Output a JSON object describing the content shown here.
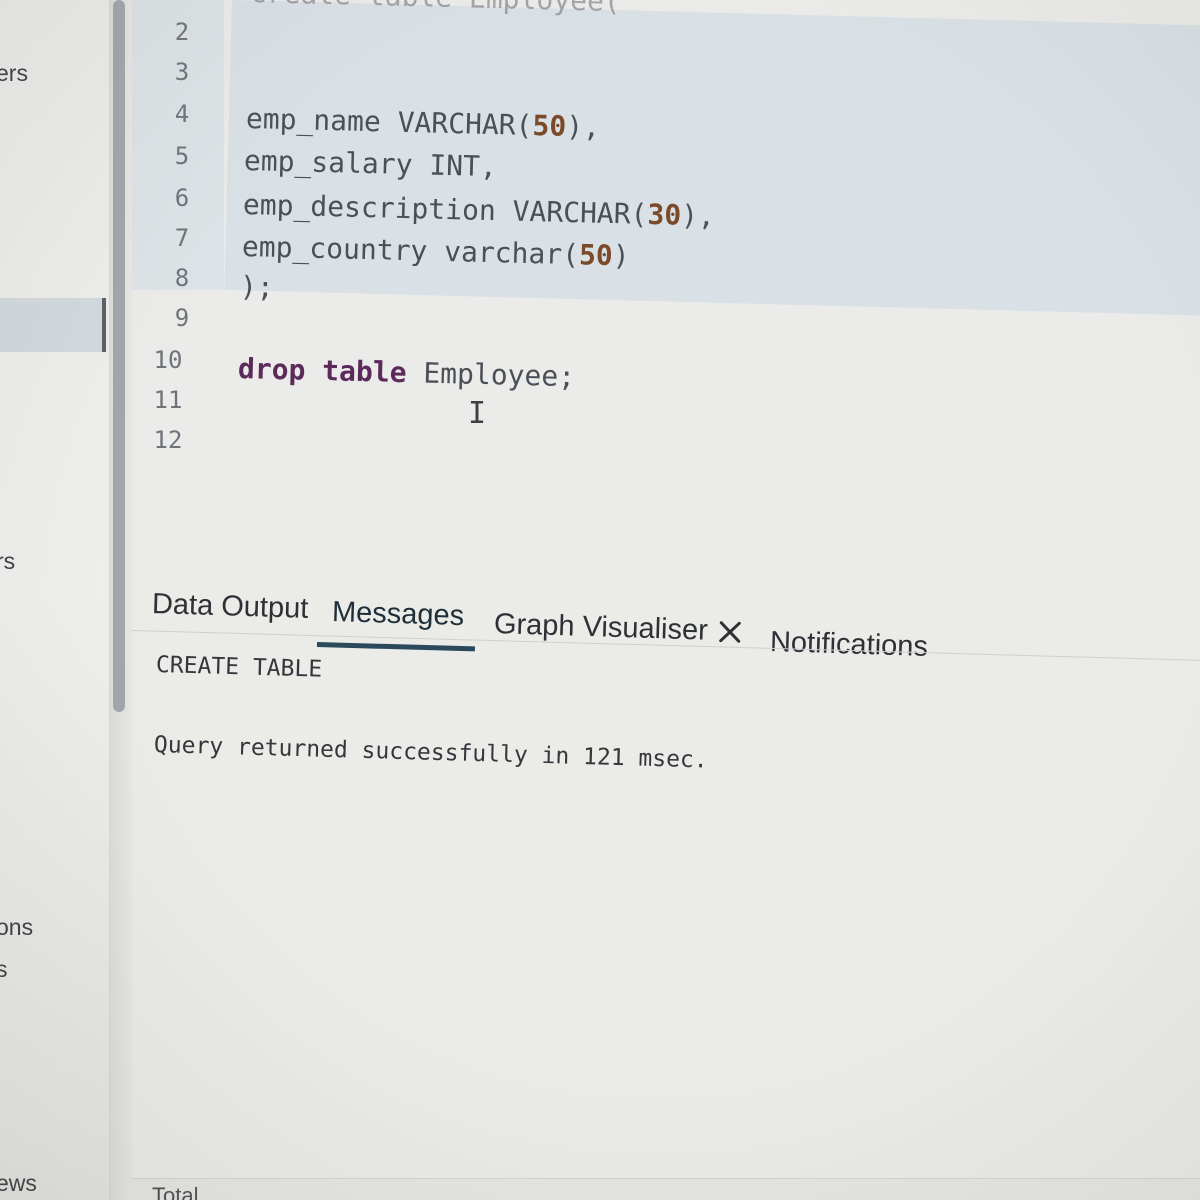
{
  "sidebar": {
    "items": [
      {
        "label": "ers"
      },
      {
        "label": "rs"
      },
      {
        "label": "ons"
      },
      {
        "label": "s"
      },
      {
        "label": "ews"
      }
    ]
  },
  "editor": {
    "line_numbers": [
      "2",
      "3",
      "4",
      "5",
      "6",
      "7",
      "8",
      "9",
      "10",
      "11",
      "12"
    ],
    "partial_top_line": "create table Employee(",
    "lines": {
      "l4": {
        "ident": "emp_name ",
        "type": "VARCHAR(",
        "num": "50",
        "end": "),"
      },
      "l5": {
        "ident": "emp_salary ",
        "type": "INT,"
      },
      "l6": {
        "ident": "emp_description ",
        "type": "VARCHAR(",
        "num": "30",
        "end": "),"
      },
      "l7": {
        "ident": "emp_country ",
        "type": "varchar(",
        "num": "50",
        "end": ")"
      },
      "l8": {
        "text": ");"
      },
      "l10": {
        "kw1": "drop",
        "kw2": "table",
        "ident": " Employee;"
      }
    },
    "cursor_glyph": "I"
  },
  "panel": {
    "tabs": [
      {
        "label": "Data Output"
      },
      {
        "label": "Messages"
      },
      {
        "label": "Graph Visualiser"
      },
      {
        "label": "Notifications"
      }
    ],
    "active_tab": "Messages",
    "messages": {
      "line1": "CREATE TABLE",
      "line2": "Query returned successfully in 121 msec."
    },
    "status_partial": "Total"
  },
  "colors": {
    "keyword": "#5b2a5a",
    "number": "#7a4a2a",
    "selection": "#d9e1e6",
    "active_tab_underline": "#2a4a5c"
  }
}
